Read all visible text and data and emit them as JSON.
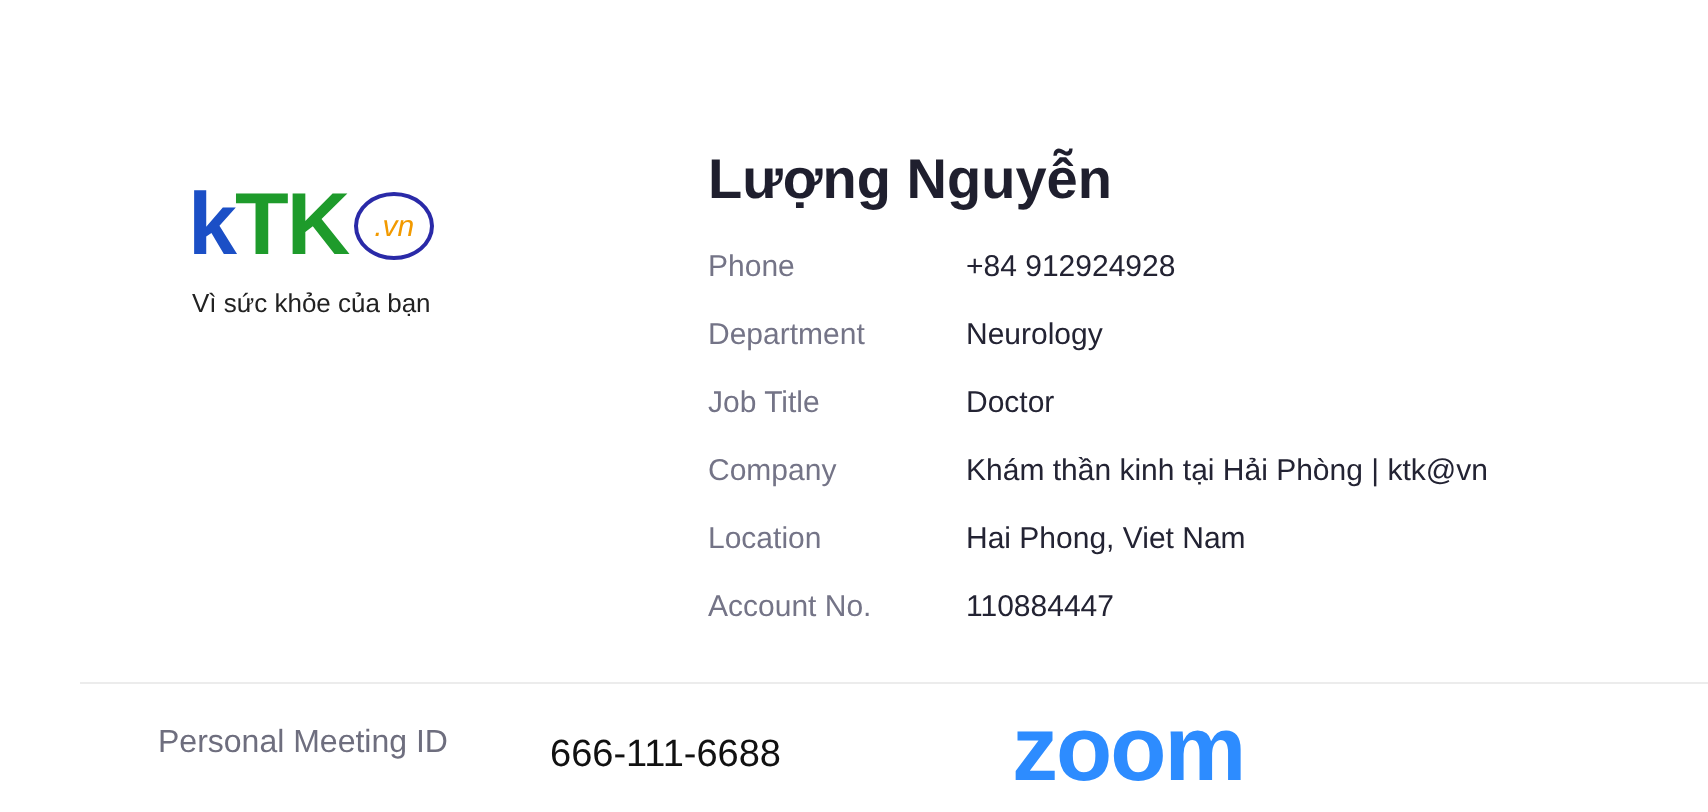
{
  "logo": {
    "parts": [
      {
        "text": "k",
        "color": "#1b4fc6"
      },
      {
        "text": "TK",
        "color": "#1e9b2b"
      }
    ],
    "badge": ".vn",
    "tagline": "Vì sức khỏe của bạn"
  },
  "profile": {
    "name": "Lượng Nguyễn",
    "fields": [
      {
        "label": "Phone",
        "value": "+84 912924928"
      },
      {
        "label": "Department",
        "value": "Neurology"
      },
      {
        "label": "Job Title",
        "value": "Doctor"
      },
      {
        "label": "Company",
        "value": "Khám thần kinh tại Hải Phòng | ktk@vn"
      },
      {
        "label": "Location",
        "value": "Hai Phong, Viet Nam"
      },
      {
        "label": "Account No.",
        "value": "110884447"
      }
    ]
  },
  "meeting": {
    "label": "Personal Meeting ID",
    "value": "666-111-6688",
    "brand": "zoom"
  }
}
